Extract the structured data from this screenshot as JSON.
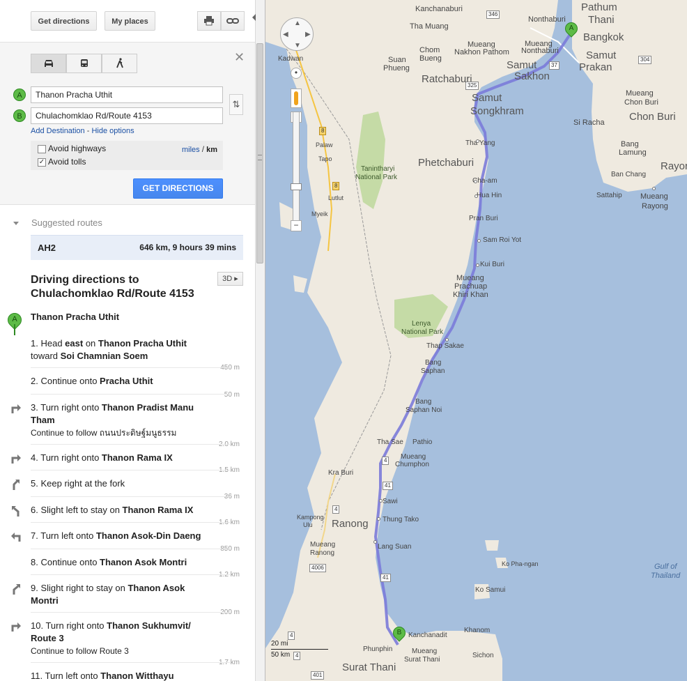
{
  "toolbar": {
    "get_directions": "Get directions",
    "my_places": "My places",
    "print_icon": "printer-icon",
    "link_icon": "link-icon"
  },
  "modes": {
    "car": "car-icon",
    "transit": "bus-icon",
    "walk": "walk-icon"
  },
  "route_inputs": {
    "a_marker": "A",
    "a_value": "Thanon Pracha Uthit",
    "b_marker": "B",
    "b_value": "Chulachomklao Rd/Route 4153",
    "add_destination": "Add Destination",
    "separator": " - ",
    "hide_options": "Hide options"
  },
  "options": {
    "avoid_highways": "Avoid highways",
    "avoid_highways_checked": false,
    "avoid_tolls": "Avoid tolls",
    "avoid_tolls_checked": true,
    "miles": "miles",
    "slash": "/",
    "km": "km",
    "get_directions_button": "GET DIRECTIONS"
  },
  "suggested": {
    "heading": "Suggested routes",
    "route_name": "AH2",
    "route_info": "646 km, 9 hours 39 mins"
  },
  "directions": {
    "title": "Driving directions to Chulachomklao Rd/Route 4153",
    "btn_3d": "3D",
    "start_marker": "A",
    "start_name": "Thanon Pracha Uthit",
    "steps": [
      {
        "num": "1.",
        "pre": "Head ",
        "b1": "east",
        "mid": " on ",
        "b2": "Thanon Pracha Uthit",
        "line2pre": "toward ",
        "line2b": "Soi Chamnian Soem",
        "dist": "450 m"
      },
      {
        "num": "2.",
        "pre": "Continue onto ",
        "b1": "Pracha Uthit",
        "dist": "50 m"
      },
      {
        "num": "3.",
        "pre": "Turn right onto ",
        "b1": "Thanon Pradist Manu Tham",
        "sub": "Continue to follow ถนนประดิษฐ์มนูธรรม",
        "dist": "2.0 km"
      },
      {
        "num": "4.",
        "pre": "Turn right onto ",
        "b1": "Thanon Rama IX",
        "dist": "1.5 km"
      },
      {
        "num": "5.",
        "pre": "Keep right at the fork",
        "dist": "36 m"
      },
      {
        "num": "6.",
        "pre": "Slight left to stay on ",
        "b1": "Thanon Rama IX",
        "dist": "1.6 km"
      },
      {
        "num": "7.",
        "pre": "Turn left onto ",
        "b1": "Thanon Asok-Din Daeng",
        "dist": "850 m"
      },
      {
        "num": "8.",
        "pre": "Continue onto ",
        "b1": "Thanon Asok Montri",
        "dist": "1.2 km"
      },
      {
        "num": "9.",
        "pre": "Slight right to stay on ",
        "b1": "Thanon Asok Montri",
        "dist": "200 m"
      },
      {
        "num": "10.",
        "pre": "Turn right onto ",
        "b1": "Thanon Sukhumvit/ Route 3",
        "sub": "Continue to follow Route 3",
        "dist": "1.7 km"
      },
      {
        "num": "11.",
        "pre": "Turn left onto ",
        "b1": "Thanon Witthayu"
      }
    ]
  },
  "map": {
    "labels": {
      "kanchanaburi": "Kanchanaburi",
      "tha_muang": "Tha Muang",
      "nonthaburi": "Nonthaburi",
      "pathum_thani": "Pathum",
      "pathum_thani2": "Thani",
      "bangkok": "Bangkok",
      "mueang_nonthaburi": "Mueang",
      "mueang_nonthaburi2": "Nonthaburi",
      "chom_bueng": "Chom",
      "chom_bueng2": "Bueng",
      "mueang_np": "Mueang",
      "mueang_np2": "Nakhon Pathom",
      "suan_phueng": "Suan",
      "suan_phueng2": "Phueng",
      "ratchaburi": "Ratchaburi",
      "samut_sakhon": "Samut",
      "samut_sakhon2": "Sakhon",
      "samut_prakan": "Samut",
      "samut_prakan2": "Prakan",
      "samut_songkhram": "Samut",
      "samut_songkhram2": "Songkhram",
      "kadwan": "Kadwan",
      "mueang_chonburi": "Mueang",
      "mueang_chonburi2": "Chon Buri",
      "si_racha": "Si Racha",
      "chon_buri": "Chon Buri",
      "bang_lamung": "Bang",
      "bang_lamung2": "Lamung",
      "rayong": "Rayor",
      "ban_chang": "Ban Chang",
      "sattahip": "Sattahip",
      "mueang_rayong": "Mueang",
      "mueang_rayong2": "Rayong",
      "tha_yang": "Tha Yang",
      "phetchaburi": "Phetchaburi",
      "tanintharyi": "Tanintharyi",
      "tanintharyi2": "National Park",
      "palaw": "Palaw",
      "tapo": "Tapo",
      "cha_am": "Cha-am",
      "hua_hin": "Hua Hin",
      "lutlut": "Lutlut",
      "myeik": "Myeik",
      "pran_buri": "Pran Buri",
      "sam_roi_yot": "Sam Roi Yot",
      "kui_buri": "Kui Buri",
      "mpkk": "Mueang",
      "mpkk2": "Prachuap",
      "mpkk3": "Khiri Khan",
      "lenya": "Lenya",
      "lenya2": "National Park",
      "thap_sakae": "Thap Sakae",
      "bang_saphan": "Bang",
      "bang_saphan2": "Saphan",
      "bang_saphan_noi": "Bang",
      "bang_saphan_noi2": "Saphan Noi",
      "tha_sae": "Tha Sae",
      "pathio": "Pathio",
      "mueang_chumphon": "Mueang",
      "mueang_chumphon2": "Chumphon",
      "kra_buri": "Kra Buri",
      "kampong": "Kampong",
      "kampong2": "Ulu",
      "ranong": "Ranong",
      "sawi": "Sawi",
      "thung_tako": "Thung Tako",
      "mueang_ranong": "Mueang",
      "mueang_ranong2": "Ranong",
      "lang_suan": "Lang Suan",
      "ko_phangan": "Ko Pha-ngan",
      "gulf": "Gulf of",
      "gulf2": "Thailand",
      "ko_samui": "Ko Samui",
      "kanchanadit": "Kanchanadit",
      "khanom": "Khanom",
      "phunphin": "Phunphin",
      "mueang_surat": "Mueang",
      "mueang_surat2": "Surat Thani",
      "sichon": "Sichon",
      "surat_thani": "Surat Thani"
    },
    "shields": {
      "s346": "346",
      "s304": "304",
      "s37": "37",
      "s325": "325",
      "s8a": "8",
      "s8b": "8",
      "s4a": "4",
      "s4b": "4",
      "s41a": "41",
      "s41b": "41",
      "s4006": "4006",
      "s4c": "4",
      "s401": "401",
      "s4d": "4"
    },
    "marker_a": "A",
    "marker_b": "B",
    "scale_mi": "20 mi",
    "scale_km": "50 km",
    "route_color": "#7b7bd9",
    "water_color": "#a6bfdd",
    "land_color": "#efeae0",
    "park_color": "#c5dba6"
  }
}
